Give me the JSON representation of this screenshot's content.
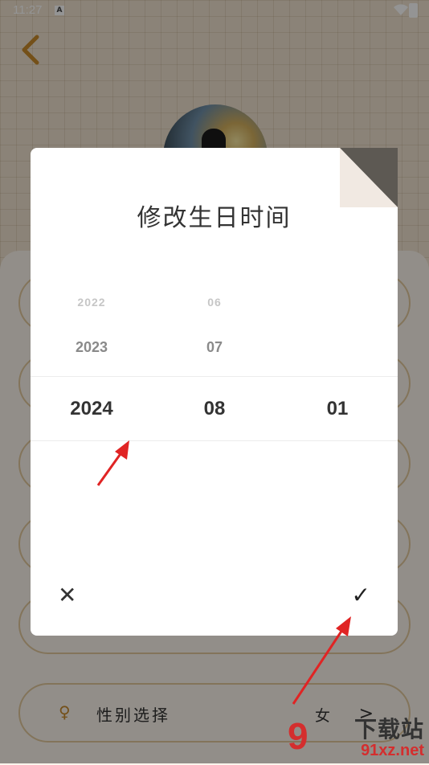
{
  "status_bar": {
    "time": "11:27",
    "notification_icon": "A"
  },
  "header": {
    "back_icon": "chevron-left-icon"
  },
  "profile_rows": [
    {
      "label": "",
      "value": ""
    },
    {
      "label": "",
      "value": ""
    },
    {
      "label": "",
      "value": ""
    },
    {
      "label": "",
      "value": ""
    },
    {
      "label": "",
      "value": ""
    },
    {
      "label": "性别选择",
      "value": "女",
      "icon": "gender-icon"
    }
  ],
  "dialog": {
    "title": "修改生日时间",
    "year_column": [
      "2022",
      "2023",
      "2024"
    ],
    "month_column": [
      "06",
      "07",
      "08"
    ],
    "day_column": [
      "01"
    ],
    "selected": {
      "year": "2024",
      "month": "08",
      "day": "01"
    },
    "cancel_icon": "✕",
    "confirm_icon": "✓"
  },
  "watermark": {
    "text": "下载站",
    "url": "91xz.net",
    "logo": "9"
  },
  "colors": {
    "accent": "#c88a2c",
    "annotation": "#e02424",
    "dialog_fold": "#f1e9e2"
  }
}
